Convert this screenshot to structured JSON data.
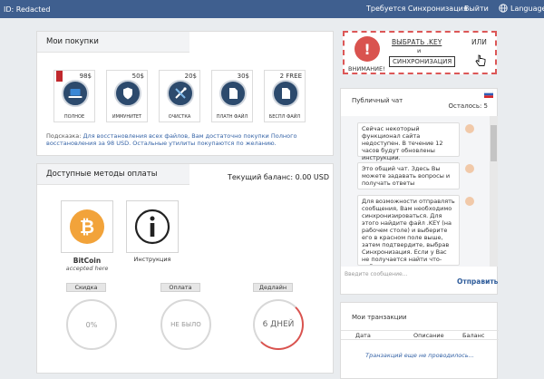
{
  "topbar": {
    "id_label": "ID: Redacted",
    "sync": "Требуется Синхронизация",
    "exit": "Выйти",
    "language": "Language"
  },
  "purchases": {
    "title": "Мои покупки",
    "products": [
      {
        "label": "ПОЛНОЕ",
        "price": "98$",
        "icon": "laptop-icon"
      },
      {
        "label": "ИММУНИТЕТ",
        "price": "50$",
        "icon": "shield-icon"
      },
      {
        "label": "ОЧИСТКА",
        "price": "20$",
        "icon": "tools-icon"
      },
      {
        "label": "ПЛАТН ФАЙЛ",
        "price": "30$",
        "icon": "file-icon"
      },
      {
        "label": "БЕСПЛ ФАЙЛ",
        "price": "2 FREE",
        "icon": "file-icon"
      }
    ],
    "hint_prefix": "Подсказка: ",
    "hint_text": "Для восстановления всех файлов, Вам достаточно покупки Полного восстановления за 98 USD. Остальные утилиты покупаются по желанию."
  },
  "payment": {
    "title": "Доступные методы оплаты",
    "balance": "Текущий баланс: 0.00 USD",
    "bitcoin_name": "BitCoin",
    "bitcoin_sub": "accepted here",
    "instruction_label": "Инструкция",
    "stats": [
      {
        "label": "Скидка",
        "value": "0%"
      },
      {
        "label": "Оплата",
        "value": "НЕ БЫЛО"
      },
      {
        "label": "Дедлайн",
        "value": "6 ДНЕЙ"
      }
    ]
  },
  "warning": {
    "label": "ВНИМАНИЕ!",
    "select_key": "ВЫБРАТЬ .KEY",
    "and": "и",
    "sync_button": "СИНХРОНИЗАЦИЯ",
    "or": "ИЛИ"
  },
  "chat": {
    "title": "Публичный чат",
    "remaining": "Осталось: 5",
    "messages": [
      "Сейчас некоторый функционал сайта недоступен. В течение 12 часов будут обновлены инструкции.",
      "Это общий чат. Здесь Вы можете задавать вопросы и получать ответы",
      "Для возможности отправлять сообщения, Вам необходимо синхронизироваться. Для этого найдите файл .KEY (на рабочем столе) и выберите его в красном поле выше, затем подтвердите, выбрав Синхронизация. Если у Вас не получается найти что-либо, внизу"
    ],
    "input_placeholder": "Введите сообщение...",
    "send": "Отправить"
  },
  "transactions": {
    "title": "Мои транзакции",
    "columns": [
      "Дата",
      "Описание",
      "Баланс"
    ],
    "empty": "Транзакций еще не проводилось..."
  }
}
